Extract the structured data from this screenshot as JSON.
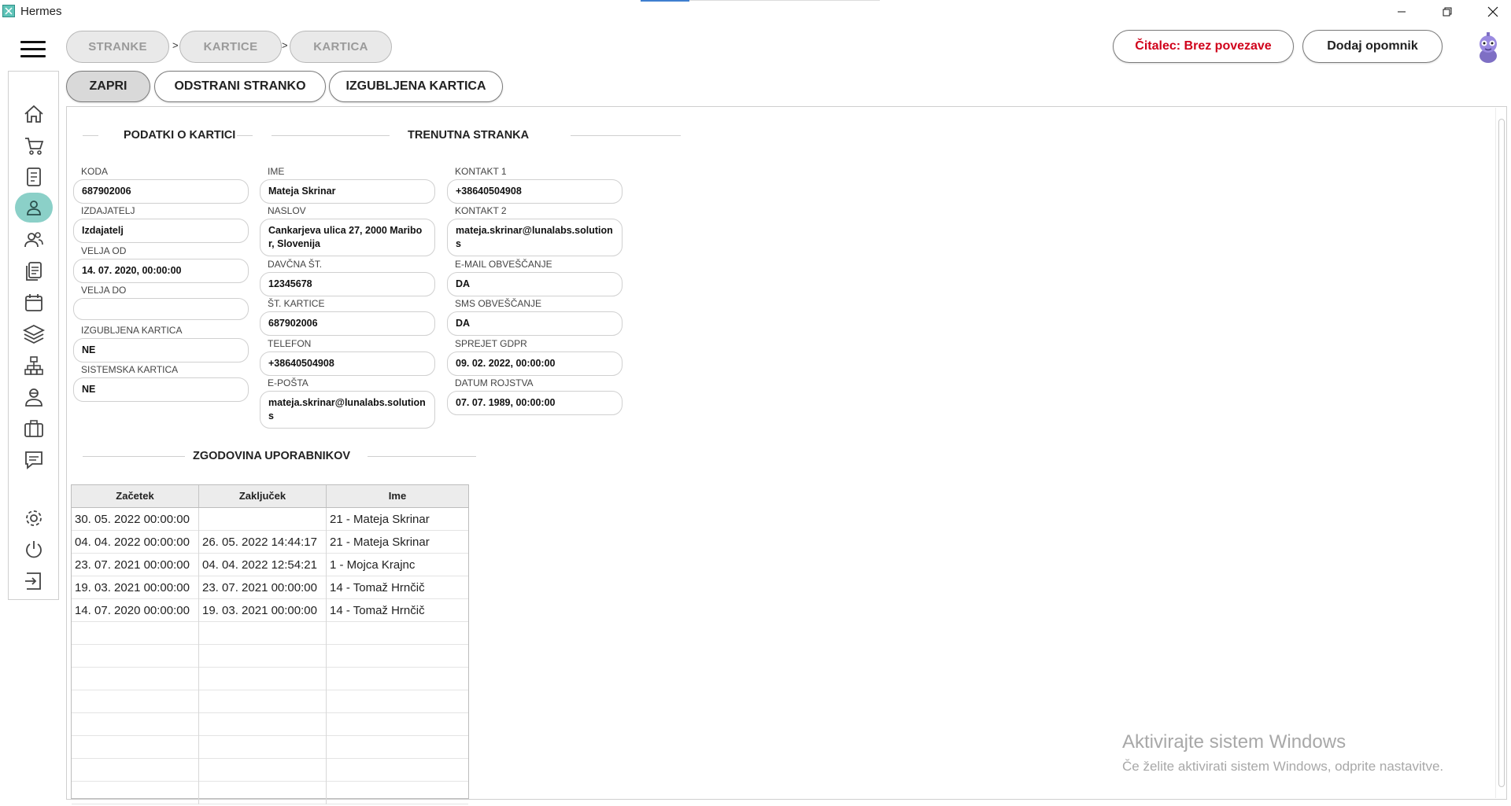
{
  "window": {
    "title": "Hermes"
  },
  "breadcrumbs": [
    "STRANKE",
    "KARTICE",
    "KARTICA"
  ],
  "breadcrumb_separator": ">",
  "top_buttons": {
    "reader_status": "Čitalec: Brez povezave",
    "add_reminder": "Dodaj opomnik"
  },
  "colors": {
    "reader_status": "#d0021b",
    "active_nav": "#8bd0c8",
    "accent": "#3f7fd0"
  },
  "sidebar": {
    "items": [
      {
        "icon": "home-icon"
      },
      {
        "icon": "cart-icon"
      },
      {
        "icon": "document-icon"
      },
      {
        "icon": "user-icon",
        "active": true
      },
      {
        "icon": "users-icon"
      },
      {
        "icon": "list-icon"
      },
      {
        "icon": "calendar-icon"
      },
      {
        "icon": "layers-icon"
      },
      {
        "icon": "network-icon"
      },
      {
        "icon": "person-badge-icon"
      },
      {
        "icon": "briefcase-icon"
      },
      {
        "icon": "chat-icon"
      },
      {
        "icon": "gear-icon"
      },
      {
        "icon": "power-icon"
      },
      {
        "icon": "logout-icon"
      }
    ]
  },
  "actions": {
    "close": "ZAPRI",
    "remove_customer": "ODSTRANI STRANKO",
    "lost_card": "IZGUBLJENA KARTICA"
  },
  "sections": {
    "card_data": "PODATKI O KARTICI",
    "current_customer": "TRENUTNA STRANKA",
    "user_history": "ZGODOVINA UPORABNIKOV"
  },
  "card": {
    "koda": {
      "label": "KODA",
      "value": "687902006"
    },
    "izdajatelj": {
      "label": "IZDAJATELJ",
      "value": "Izdajatelj"
    },
    "velja_od": {
      "label": "VELJA OD",
      "value": "14. 07. 2020, 00:00:00"
    },
    "velja_do": {
      "label": "VELJA DO",
      "value": ""
    },
    "izgubljena": {
      "label": "IZGUBLJENA KARTICA",
      "value": "NE"
    },
    "sistemska": {
      "label": "SISTEMSKA KARTICA",
      "value": "NE"
    }
  },
  "customer": {
    "ime": {
      "label": "IME",
      "value": "Mateja Skrinar"
    },
    "naslov": {
      "label": "NASLOV",
      "value": "Cankarjeva ulica 27, 2000 Maribor, Slovenija"
    },
    "davcna": {
      "label": "DAVČNA ŠT.",
      "value": "12345678"
    },
    "st_kartice": {
      "label": "ŠT. KARTICE",
      "value": "687902006"
    },
    "telefon": {
      "label": "TELEFON",
      "value": "+38640504908"
    },
    "eposta": {
      "label": "E-POŠTA",
      "value": "mateja.skrinar@lunalabs.solutions"
    },
    "kontakt1": {
      "label": "KONTAKT 1",
      "value": "+38640504908"
    },
    "kontakt2": {
      "label": "KONTAKT 2",
      "value": "mateja.skrinar@lunalabs.solutions"
    },
    "email_obv": {
      "label": "E-MAIL OBVEŠČANJE",
      "value": "DA"
    },
    "sms_obv": {
      "label": "SMS OBVEŠČANJE",
      "value": "DA"
    },
    "gdpr": {
      "label": "SPREJET GDPR",
      "value": "09. 02. 2022, 00:00:00"
    },
    "rojstvo": {
      "label": "DATUM ROJSTVA",
      "value": "07. 07. 1989, 00:00:00"
    }
  },
  "history": {
    "columns": [
      "Začetek",
      "Zaključek",
      "Ime"
    ],
    "rows": [
      [
        "30. 05. 2022 00:00:00",
        "",
        "21 - Mateja Skrinar"
      ],
      [
        "04. 04. 2022 00:00:00",
        "26. 05. 2022 14:44:17",
        "21 - Mateja Skrinar"
      ],
      [
        "23. 07. 2021 00:00:00",
        "04. 04. 2022 12:54:21",
        "1 - Mojca Krajnc"
      ],
      [
        "19. 03. 2021 00:00:00",
        "23. 07. 2021 00:00:00",
        "14 - Tomaž Hrnčič"
      ],
      [
        "14. 07. 2020 00:00:00",
        "19. 03. 2021 00:00:00",
        "14 - Tomaž Hrnčič"
      ]
    ],
    "empty_rows": 8
  },
  "watermark": {
    "line1": "Aktivirajte sistem Windows",
    "line2": "Če želite aktivirati sistem Windows, odprite nastavitve."
  }
}
